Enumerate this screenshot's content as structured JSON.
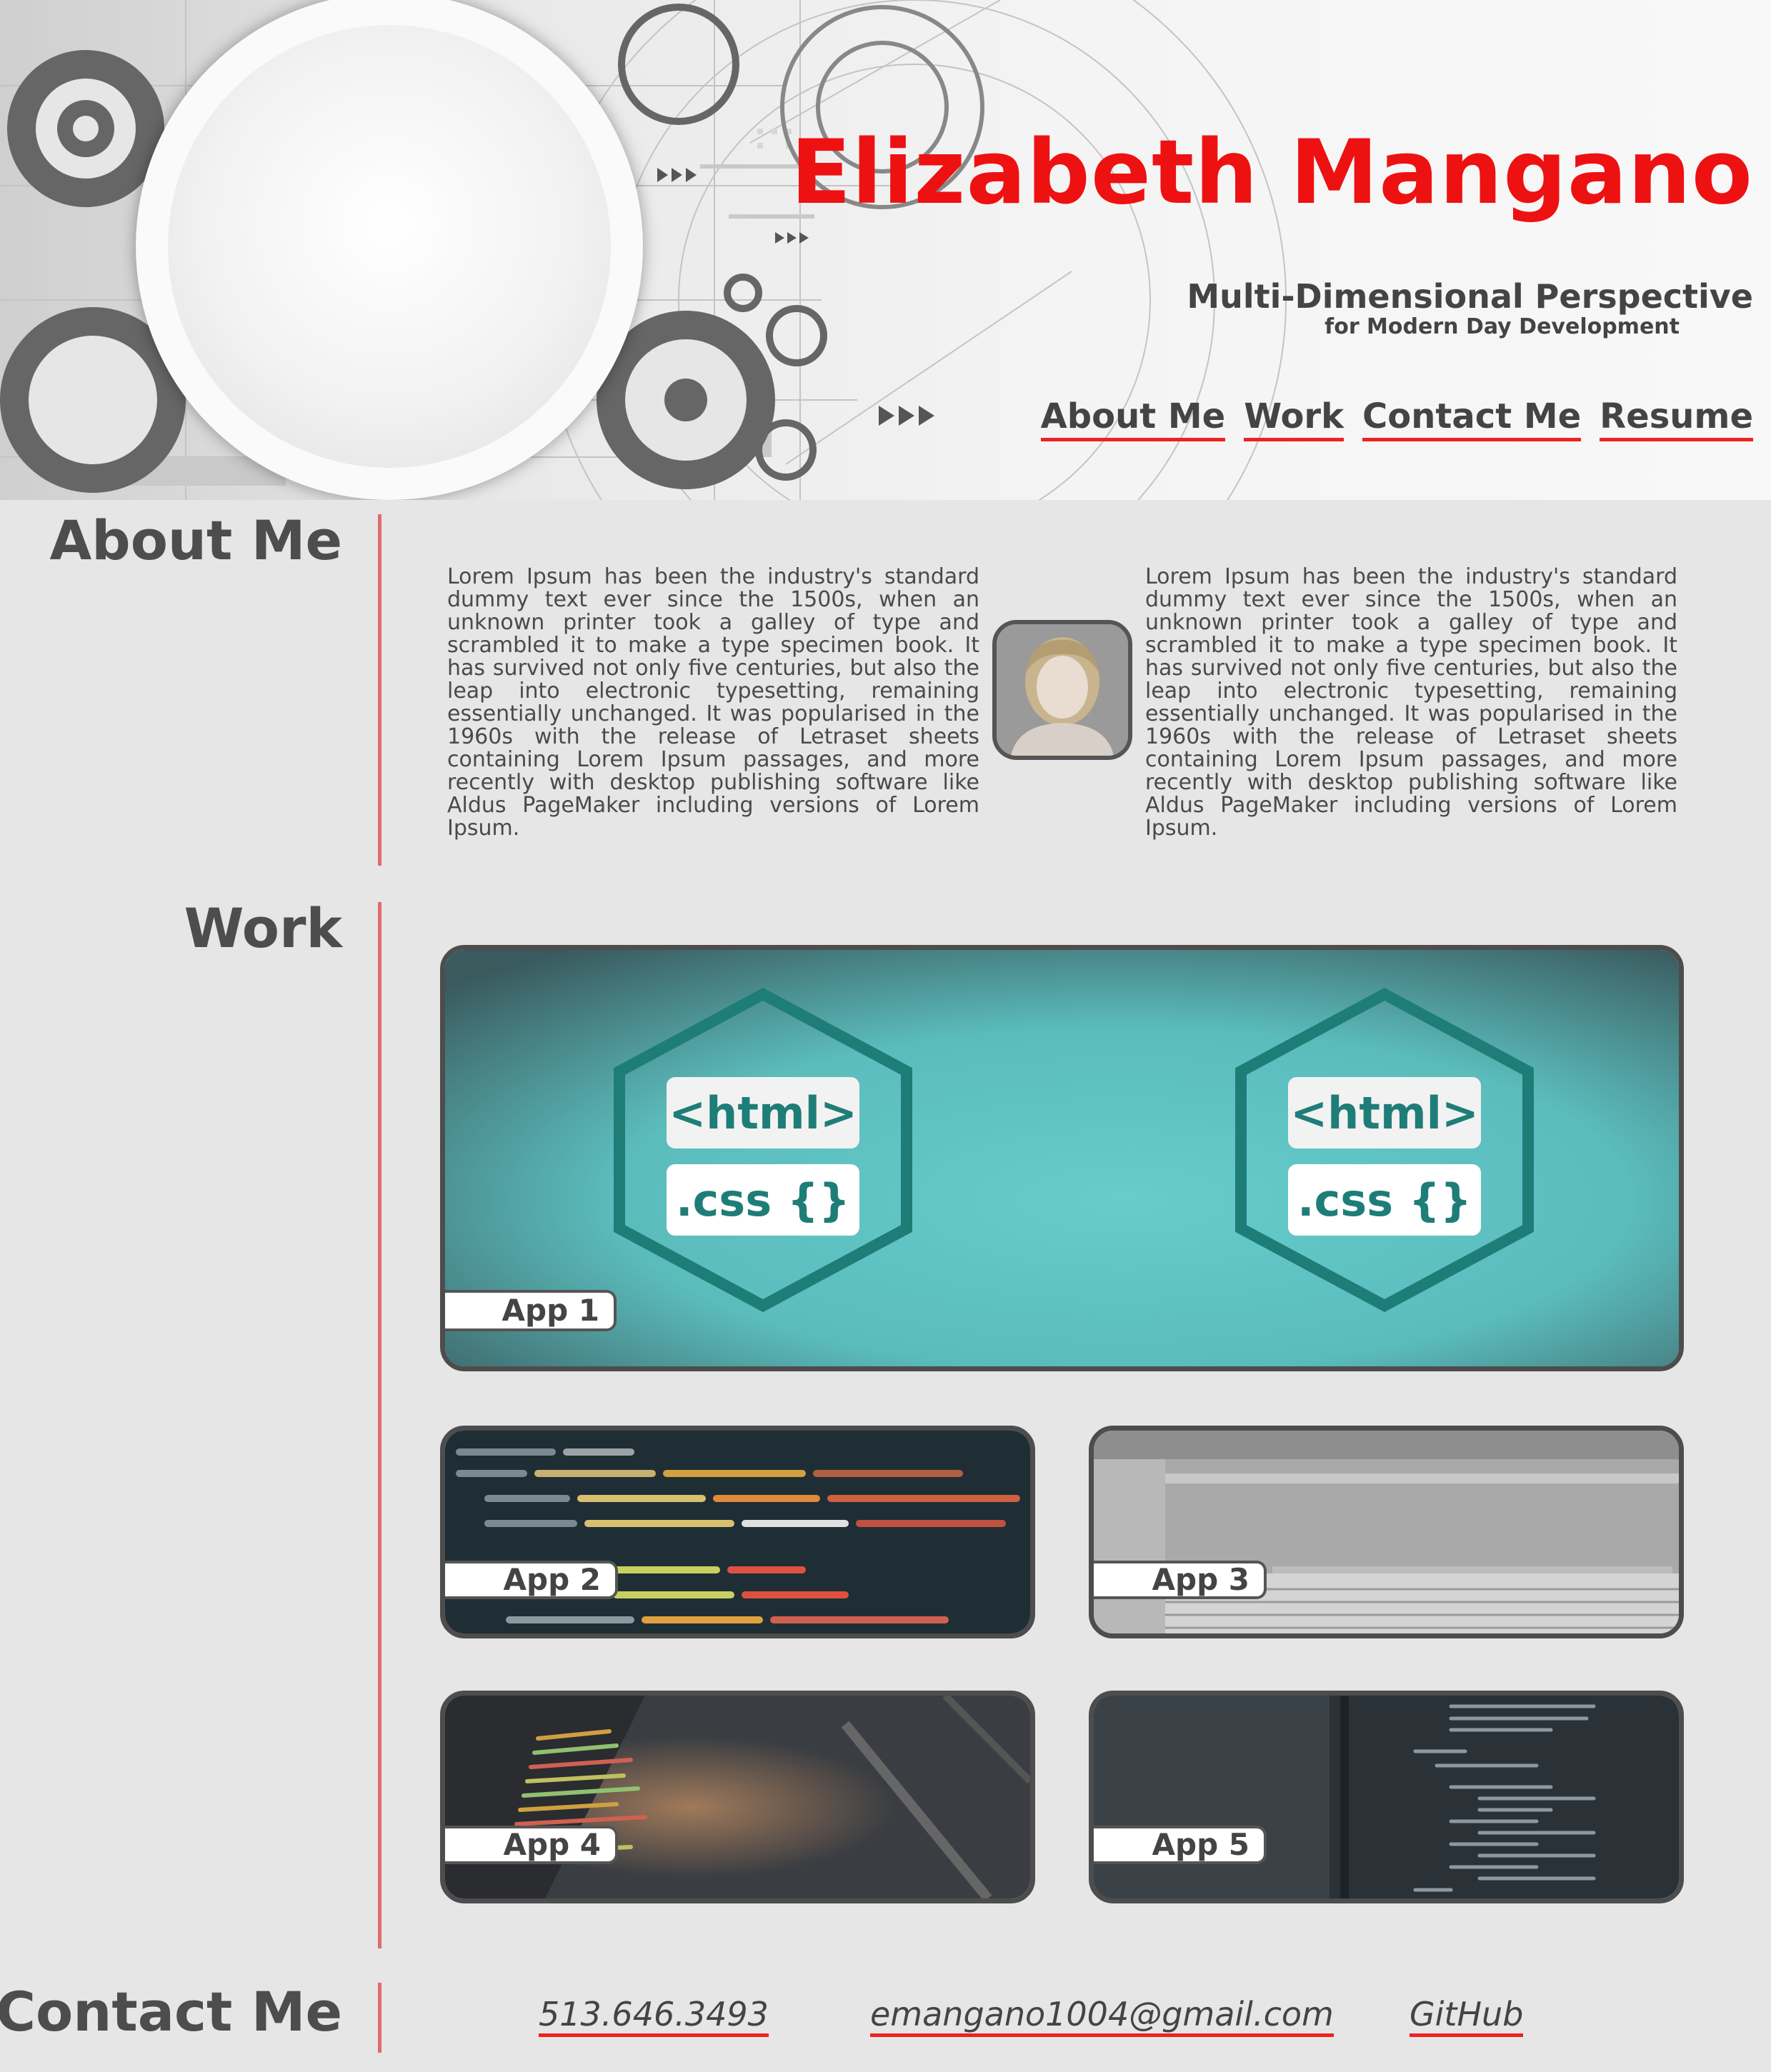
{
  "header": {
    "name": "Elizabeth Mangano",
    "tagline": "Multi-Dimensional Perspective",
    "tagline_sub": "for Modern Day Development",
    "nav": [
      "About Me",
      "Work",
      "Contact Me",
      "Resume"
    ]
  },
  "about": {
    "heading": "About Me",
    "paragraph_left": "Lorem Ipsum has been the industry's standard dummy text ever since the 1500s, when an unknown printer took a galley of type and scrambled it to make a type specimen book. It has survived not only five centuries, but also the leap into electronic typesetting, remaining essentially unchanged. It was popularised in the 1960s with the release of Letraset sheets containing Lorem Ipsum passages, and more recently with desktop publishing software like Aldus PageMaker including versions of Lorem Ipsum.",
    "paragraph_right": "Lorem Ipsum has been the industry's standard dummy text ever since the 1500s, when an unknown printer took a galley of type and scrambled it to make a type specimen book. It has survived not only five centuries, but also the leap into electronic typesetting, remaining essentially unchanged. It was popularised in the 1960s with the release of Letraset sheets containing Lorem Ipsum passages, and more recently with desktop publishing software like Aldus PageMaker including versions of Lorem Ipsum."
  },
  "work": {
    "heading": "Work",
    "apps": [
      "App 1",
      "App 2",
      "App 3",
      "App 4",
      "App 5"
    ],
    "badge_html": "<html>",
    "badge_css": ".css {}"
  },
  "contact": {
    "heading": "Contact Me",
    "phone": "513.646.3493",
    "email": "emangano1004@gmail.com",
    "github": "GitHub"
  },
  "colors": {
    "accent": "#ee1111",
    "divider": "#e06b6b",
    "text": "#4a4a4a",
    "background": "#e6e6e6",
    "teal": "#5ec3c3"
  }
}
